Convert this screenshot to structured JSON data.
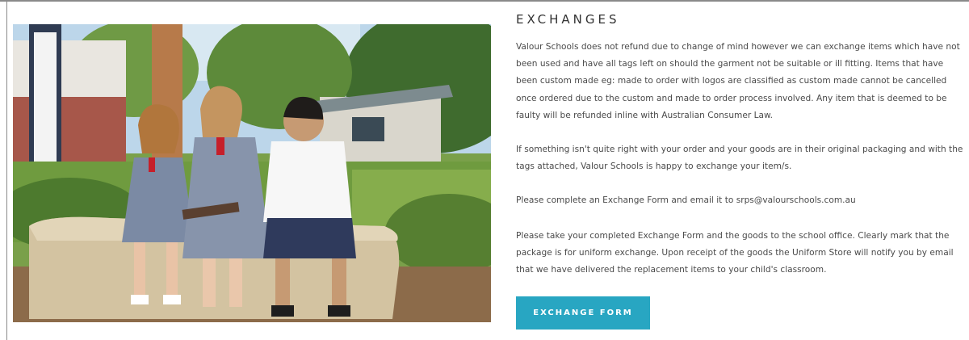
{
  "section": {
    "heading": "EXCHANGES",
    "paragraphs": [
      "Valour Schools does not refund due to change of mind however we can exchange items which have not been used and have all tags left on should the garment not be suitable or ill fitting. Items that have been custom made eg: made to order with logos are classified as custom made cannot be cancelled once ordered due to the custom and made to order process involved. Any item that is deemed to be faulty will be refunded inline with Australian Consumer Law.",
      "If something isn't quite right with your order and your goods are in their original packaging and with the tags attached, Valour Schools is happy to exchange your item/s.",
      "Please complete an Exchange Form and email it to srps@valourschools.com.au",
      "Please take your completed Exchange Form and the goods to the school office. Clearly mark that the package is for uniform exchange. Upon receipt of the goods the Uniform Store will notify you by email that we have delivered the replacement items to your child's classroom."
    ],
    "button_label": "EXCHANGE FORM"
  },
  "colors": {
    "button": "#28a6c2",
    "border": "#8a8a8a"
  }
}
